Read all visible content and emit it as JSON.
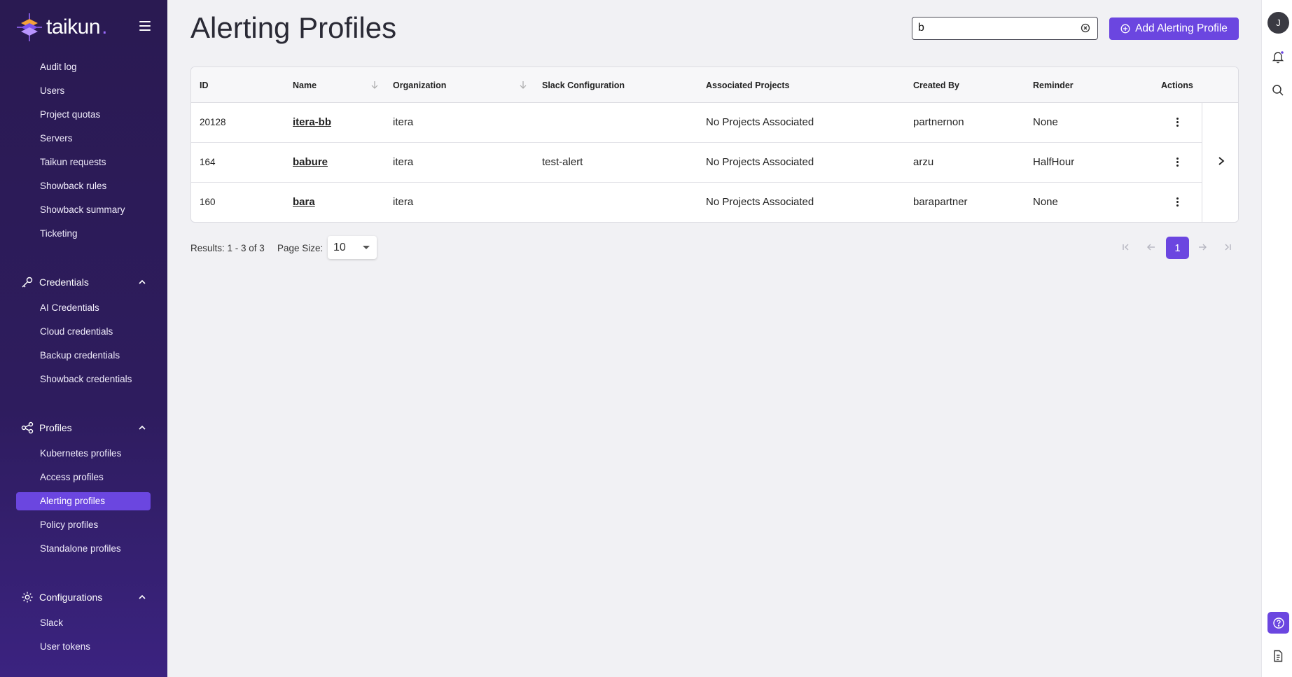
{
  "brand": {
    "name": "taikun",
    "dot": "."
  },
  "sidebar": {
    "top_items": [
      {
        "label": "Audit log"
      },
      {
        "label": "Users"
      },
      {
        "label": "Project quotas"
      },
      {
        "label": "Servers"
      },
      {
        "label": "Taikun requests"
      },
      {
        "label": "Showback rules"
      },
      {
        "label": "Showback summary"
      },
      {
        "label": "Ticketing"
      }
    ],
    "sections": [
      {
        "label": "Credentials",
        "icon": "key-icon",
        "items": [
          {
            "label": "AI Credentials"
          },
          {
            "label": "Cloud credentials"
          },
          {
            "label": "Backup credentials"
          },
          {
            "label": "Showback credentials"
          }
        ]
      },
      {
        "label": "Profiles",
        "icon": "share-icon",
        "items": [
          {
            "label": "Kubernetes profiles"
          },
          {
            "label": "Access profiles"
          },
          {
            "label": "Alerting profiles",
            "active": true
          },
          {
            "label": "Policy profiles"
          },
          {
            "label": "Standalone profiles"
          }
        ]
      },
      {
        "label": "Configurations",
        "icon": "gear-icon",
        "items": [
          {
            "label": "Slack"
          },
          {
            "label": "User tokens"
          }
        ]
      }
    ]
  },
  "header": {
    "title": "Alerting Profiles",
    "search_value": "b",
    "add_button_label": "Add Alerting Profile"
  },
  "table": {
    "columns": [
      "ID",
      "Name",
      "Organization",
      "Slack Configuration",
      "Associated Projects",
      "Created By",
      "Reminder",
      "Actions"
    ],
    "rows": [
      {
        "id": "20128",
        "name": "itera-bb",
        "organization": "itera",
        "slack": "",
        "projects": "No Projects Associated",
        "created_by": "partnernon",
        "reminder": "None"
      },
      {
        "id": "164",
        "name": "babure",
        "organization": "itera",
        "slack": "test-alert",
        "projects": "No Projects Associated",
        "created_by": "arzu",
        "reminder": "HalfHour"
      },
      {
        "id": "160",
        "name": "bara",
        "organization": "itera",
        "slack": "",
        "projects": "No Projects Associated",
        "created_by": "barapartner",
        "reminder": "None"
      }
    ]
  },
  "pagination": {
    "results_text": "Results: 1 - 3 of 3",
    "page_size_label": "Page Size:",
    "page_size": "10",
    "current_page": "1"
  },
  "user": {
    "initial": "J"
  },
  "colors": {
    "accent": "#6b46e0",
    "sidebar_bg": "#2a1a52"
  }
}
